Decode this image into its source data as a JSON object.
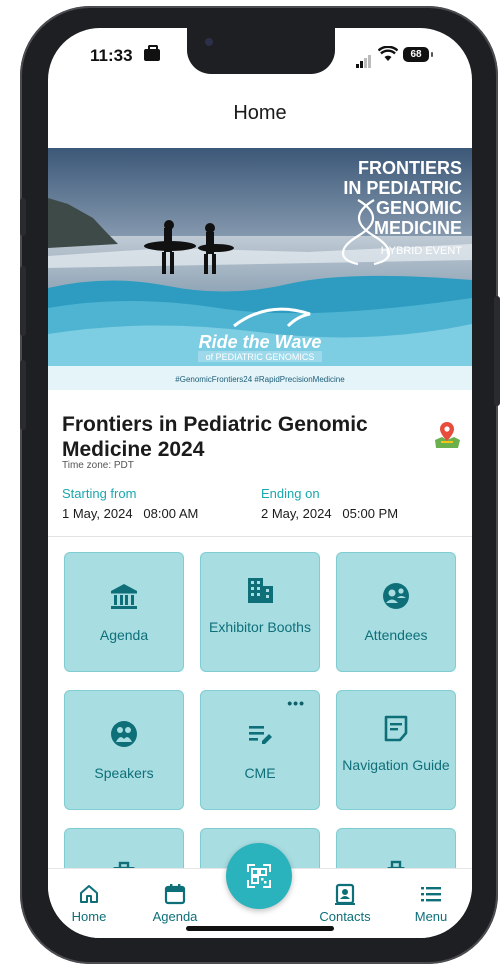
{
  "status_bar": {
    "time": "11:33",
    "battery": "68"
  },
  "header": {
    "title": "Home"
  },
  "banner": {
    "title_lines": [
      "FRONTIERS",
      "IN PEDIATRIC",
      "GENOMIC",
      "MEDICINE"
    ],
    "event_type": "HYBRID EVENT",
    "tagline": "Ride the Wave",
    "tagline_sub": "of PEDIATRIC GENOMICS",
    "hashtags": "#GenomicFrontiers24   #RapidPrecisionMedicine"
  },
  "event": {
    "title": "Frontiers in Pediatric Genomic Medicine 2024",
    "timezone": "Time zone: PDT",
    "start_label": "Starting from",
    "end_label": "Ending on",
    "start_value": "1 May, 2024   08:00 AM",
    "end_value": "2 May, 2024   05:00 PM"
  },
  "tiles": [
    {
      "label": "Agenda",
      "icon": "bank-icon"
    },
    {
      "label": "Exhibitor Booths",
      "icon": "building-icon"
    },
    {
      "label": "Attendees",
      "icon": "attendees-icon"
    },
    {
      "label": "Speakers",
      "icon": "speakers-icon"
    },
    {
      "label": "CME",
      "icon": "edit-list-icon",
      "more": "•••"
    },
    {
      "label": "Navigation Guide",
      "icon": "guide-icon"
    }
  ],
  "bottom_nav": {
    "home": "Home",
    "agenda": "Agenda",
    "contacts": "Contacts",
    "menu": "Menu"
  },
  "colors": {
    "accent": "#1aa7b0",
    "tile_bg": "#a8dde1",
    "tile_text": "#0e6f79",
    "fab": "#2ab3bc"
  }
}
